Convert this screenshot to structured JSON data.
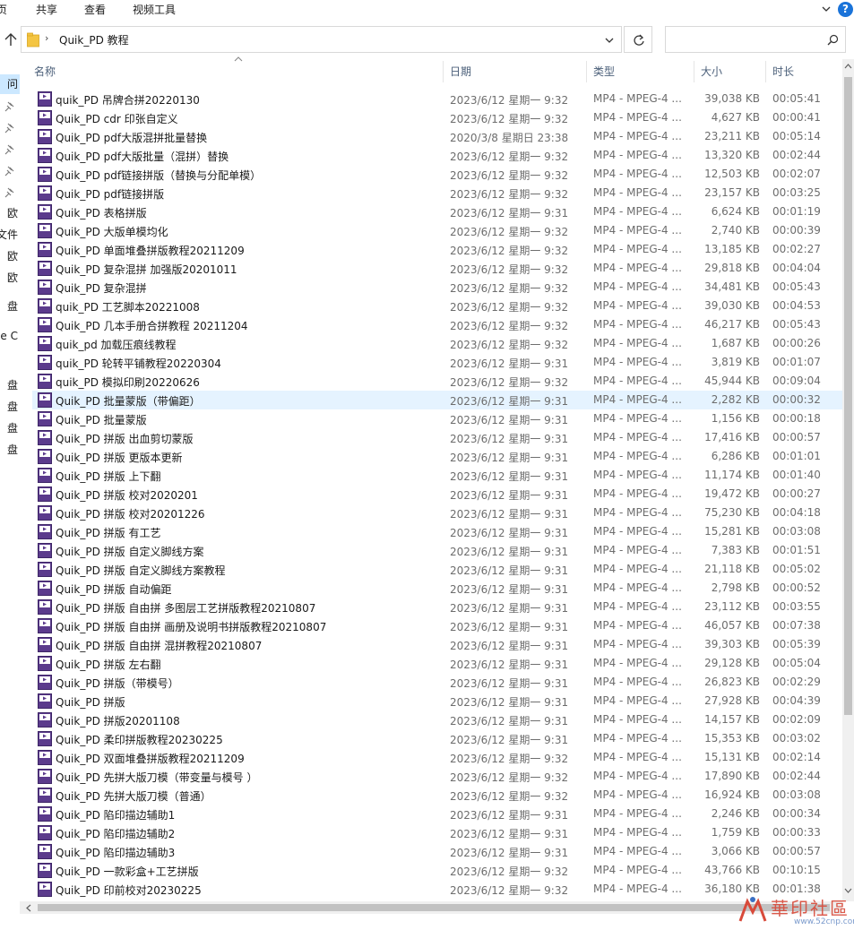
{
  "ribbon": {
    "tabs": [
      "页",
      "共享",
      "查看",
      "视频工具"
    ],
    "help_label": "?"
  },
  "address": {
    "separator": "›",
    "path": "Quik_PD 教程",
    "search_placeholder": ""
  },
  "nav": {
    "items": [
      "问",
      "",
      "",
      "",
      "",
      "",
      "欧",
      "文件",
      "欧",
      "欧",
      "",
      "盘",
      "",
      "ve C",
      "",
      "",
      "盘",
      "盘",
      "盘",
      "盘"
    ]
  },
  "columns": {
    "name": "名称",
    "date": "日期",
    "type": "类型",
    "size": "大小",
    "duration": "时长"
  },
  "files": [
    {
      "name": "quik_PD  吊牌合拼20220130",
      "date": "2023/6/12 星期一 9:32",
      "type": "MP4 - MPEG-4 ...",
      "size": "39,038 KB",
      "duration": "00:05:41"
    },
    {
      "name": "Quik_PD cdr 印张自定义",
      "date": "2023/6/12 星期一 9:32",
      "type": "MP4 - MPEG-4 ...",
      "size": "4,627 KB",
      "duration": "00:00:41"
    },
    {
      "name": "Quik_PD pdf大版混拼批量替换",
      "date": "2020/3/8 星期日 23:38",
      "type": "MP4 - MPEG-4 ...",
      "size": "23,211 KB",
      "duration": "00:05:14"
    },
    {
      "name": "Quik_PD pdf大版批量（混拼）替换",
      "date": "2023/6/12 星期一 9:32",
      "type": "MP4 - MPEG-4 ...",
      "size": "13,320 KB",
      "duration": "00:02:44"
    },
    {
      "name": "Quik_PD pdf链接拼版（替换与分配单模）",
      "date": "2023/6/12 星期一 9:32",
      "type": "MP4 - MPEG-4 ...",
      "size": "12,503 KB",
      "duration": "00:02:07"
    },
    {
      "name": "Quik_PD pdf链接拼版",
      "date": "2023/6/12 星期一 9:32",
      "type": "MP4 - MPEG-4 ...",
      "size": "23,157 KB",
      "duration": "00:03:25"
    },
    {
      "name": "Quik_PD 表格拼版",
      "date": "2023/6/12 星期一 9:31",
      "type": "MP4 - MPEG-4 ...",
      "size": "6,624 KB",
      "duration": "00:01:19"
    },
    {
      "name": "Quik_PD 大版单模均化",
      "date": "2023/6/12 星期一 9:32",
      "type": "MP4 - MPEG-4 ...",
      "size": "2,740 KB",
      "duration": "00:00:39"
    },
    {
      "name": "Quik_PD 单面堆叠拼版教程20211209",
      "date": "2023/6/12 星期一 9:32",
      "type": "MP4 - MPEG-4 ...",
      "size": "13,185 KB",
      "duration": "00:02:27"
    },
    {
      "name": "Quik_PD 复杂混拼 加强版20201011",
      "date": "2023/6/12 星期一 9:32",
      "type": "MP4 - MPEG-4 ...",
      "size": "29,818 KB",
      "duration": "00:04:04"
    },
    {
      "name": "Quik_PD 复杂混拼",
      "date": "2023/6/12 星期一 9:32",
      "type": "MP4 - MPEG-4 ...",
      "size": "34,481 KB",
      "duration": "00:05:43"
    },
    {
      "name": "quik_PD 工艺脚本20221008",
      "date": "2023/6/12 星期一 9:32",
      "type": "MP4 - MPEG-4 ...",
      "size": "39,030 KB",
      "duration": "00:04:53"
    },
    {
      "name": "Quik_PD 几本手册合拼教程 20211204",
      "date": "2023/6/12 星期一 9:32",
      "type": "MP4 - MPEG-4 ...",
      "size": "46,217 KB",
      "duration": "00:05:43"
    },
    {
      "name": "quik_pd 加载压痕线教程",
      "date": "2023/6/12 星期一 9:32",
      "type": "MP4 - MPEG-4 ...",
      "size": "1,687 KB",
      "duration": "00:00:26"
    },
    {
      "name": "quik_PD 轮转平铺教程20220304",
      "date": "2023/6/12 星期一 9:31",
      "type": "MP4 - MPEG-4 ...",
      "size": "3,819 KB",
      "duration": "00:01:07"
    },
    {
      "name": "quik_PD 模拟印刷20220626",
      "date": "2023/6/12 星期一 9:32",
      "type": "MP4 - MPEG-4 ...",
      "size": "45,944 KB",
      "duration": "00:09:04"
    },
    {
      "name": "Quik_PD 批量蒙版（带偏距）",
      "date": "2023/6/12 星期一 9:31",
      "type": "MP4 - MPEG-4 ...",
      "size": "2,282 KB",
      "duration": "00:00:32"
    },
    {
      "name": "Quik_PD 批量蒙版",
      "date": "2023/6/12 星期一 9:31",
      "type": "MP4 - MPEG-4 ...",
      "size": "1,156 KB",
      "duration": "00:00:18"
    },
    {
      "name": "Quik_PD 拼版 出血剪切蒙版",
      "date": "2023/6/12 星期一 9:31",
      "type": "MP4 - MPEG-4 ...",
      "size": "17,416 KB",
      "duration": "00:00:57"
    },
    {
      "name": "Quik_PD 拼版 更版本更新",
      "date": "2023/6/12 星期一 9:31",
      "type": "MP4 - MPEG-4 ...",
      "size": "6,286 KB",
      "duration": "00:01:01"
    },
    {
      "name": "Quik_PD 拼版 上下翻",
      "date": "2023/6/12 星期一 9:31",
      "type": "MP4 - MPEG-4 ...",
      "size": "11,174 KB",
      "duration": "00:01:40"
    },
    {
      "name": "Quik_PD 拼版 校对2020201",
      "date": "2023/6/12 星期一 9:31",
      "type": "MP4 - MPEG-4 ...",
      "size": "19,472 KB",
      "duration": "00:00:27"
    },
    {
      "name": "Quik_PD 拼版 校对20201226",
      "date": "2023/6/12 星期一 9:31",
      "type": "MP4 - MPEG-4 ...",
      "size": "75,230 KB",
      "duration": "00:04:18"
    },
    {
      "name": "Quik_PD 拼版 有工艺",
      "date": "2023/6/12 星期一 9:31",
      "type": "MP4 - MPEG-4 ...",
      "size": "15,281 KB",
      "duration": "00:03:08"
    },
    {
      "name": "Quik_PD 拼版 自定义脚线方案",
      "date": "2023/6/12 星期一 9:31",
      "type": "MP4 - MPEG-4 ...",
      "size": "7,383 KB",
      "duration": "00:01:51"
    },
    {
      "name": "Quik_PD 拼版 自定义脚线方案教程",
      "date": "2023/6/12 星期一 9:31",
      "type": "MP4 - MPEG-4 ...",
      "size": "21,118 KB",
      "duration": "00:05:02"
    },
    {
      "name": "Quik_PD 拼版 自动偏距",
      "date": "2023/6/12 星期一 9:31",
      "type": "MP4 - MPEG-4 ...",
      "size": "2,798 KB",
      "duration": "00:00:52"
    },
    {
      "name": "Quik_PD 拼版 自由拼 多图层工艺拼版教程20210807",
      "date": "2023/6/12 星期一 9:31",
      "type": "MP4 - MPEG-4 ...",
      "size": "23,112 KB",
      "duration": "00:03:55"
    },
    {
      "name": "Quik_PD 拼版 自由拼 画册及说明书拼版教程20210807",
      "date": "2023/6/12 星期一 9:31",
      "type": "MP4 - MPEG-4 ...",
      "size": "46,057 KB",
      "duration": "00:07:38"
    },
    {
      "name": "Quik_PD 拼版 自由拼 混拼教程20210807",
      "date": "2023/6/12 星期一 9:31",
      "type": "MP4 - MPEG-4 ...",
      "size": "39,303 KB",
      "duration": "00:05:39"
    },
    {
      "name": "Quik_PD 拼版 左右翻",
      "date": "2023/6/12 星期一 9:31",
      "type": "MP4 - MPEG-4 ...",
      "size": "29,128 KB",
      "duration": "00:05:04"
    },
    {
      "name": "Quik_PD 拼版（带模号）",
      "date": "2023/6/12 星期一 9:31",
      "type": "MP4 - MPEG-4 ...",
      "size": "26,823 KB",
      "duration": "00:02:29"
    },
    {
      "name": "Quik_PD 拼版",
      "date": "2023/6/12 星期一 9:31",
      "type": "MP4 - MPEG-4 ...",
      "size": "27,928 KB",
      "duration": "00:04:39"
    },
    {
      "name": "Quik_PD 拼版20201108",
      "date": "2023/6/12 星期一 9:31",
      "type": "MP4 - MPEG-4 ...",
      "size": "14,157 KB",
      "duration": "00:02:09"
    },
    {
      "name": "Quik_PD 柔印拼版教程20230225",
      "date": "2023/6/12 星期一 9:31",
      "type": "MP4 - MPEG-4 ...",
      "size": "15,353 KB",
      "duration": "00:03:02"
    },
    {
      "name": "Quik_PD 双面堆叠拼版教程20211209",
      "date": "2023/6/12 星期一 9:32",
      "type": "MP4 - MPEG-4 ...",
      "size": "15,131 KB",
      "duration": "00:02:14"
    },
    {
      "name": "Quik_PD 先拼大版刀模（带变量与模号 ）",
      "date": "2023/6/12 星期一 9:32",
      "type": "MP4 - MPEG-4 ...",
      "size": "17,890 KB",
      "duration": "00:02:44"
    },
    {
      "name": "Quik_PD 先拼大版刀模（普通）",
      "date": "2023/6/12 星期一 9:32",
      "type": "MP4 - MPEG-4 ...",
      "size": "16,924 KB",
      "duration": "00:03:08"
    },
    {
      "name": "Quik_PD 陷印描边辅助1",
      "date": "2023/6/12 星期一 9:31",
      "type": "MP4 - MPEG-4 ...",
      "size": "2,246 KB",
      "duration": "00:00:34"
    },
    {
      "name": "Quik_PD 陷印描边辅助2",
      "date": "2023/6/12 星期一 9:31",
      "type": "MP4 - MPEG-4 ...",
      "size": "1,759 KB",
      "duration": "00:00:33"
    },
    {
      "name": "Quik_PD 陷印描边辅助3",
      "date": "2023/6/12 星期一 9:31",
      "type": "MP4 - MPEG-4 ...",
      "size": "3,066 KB",
      "duration": "00:00:57"
    },
    {
      "name": "Quik_PD 一款彩盒+工艺拼版",
      "date": "2023/6/12 星期一 9:32",
      "type": "MP4 - MPEG-4 ...",
      "size": "43,766 KB",
      "duration": "00:10:15"
    },
    {
      "name": "Quik_PD 印前校对20230225",
      "date": "2023/6/12 星期一 9:32",
      "type": "MP4 - MPEG-4 ...",
      "size": "36,180 KB",
      "duration": "00:01:38"
    }
  ],
  "selected_index": 16,
  "file_icon_label": "MP4",
  "watermark": {
    "text": "華印社區",
    "url": "www.52cnp.com"
  },
  "colors": {
    "selected_row": "#e5f3ff",
    "nav_selected": "#cce8ff",
    "header_text": "#4c607a",
    "icon_purple": "#5b3b8c",
    "accent_blue": "#1a73d9"
  }
}
